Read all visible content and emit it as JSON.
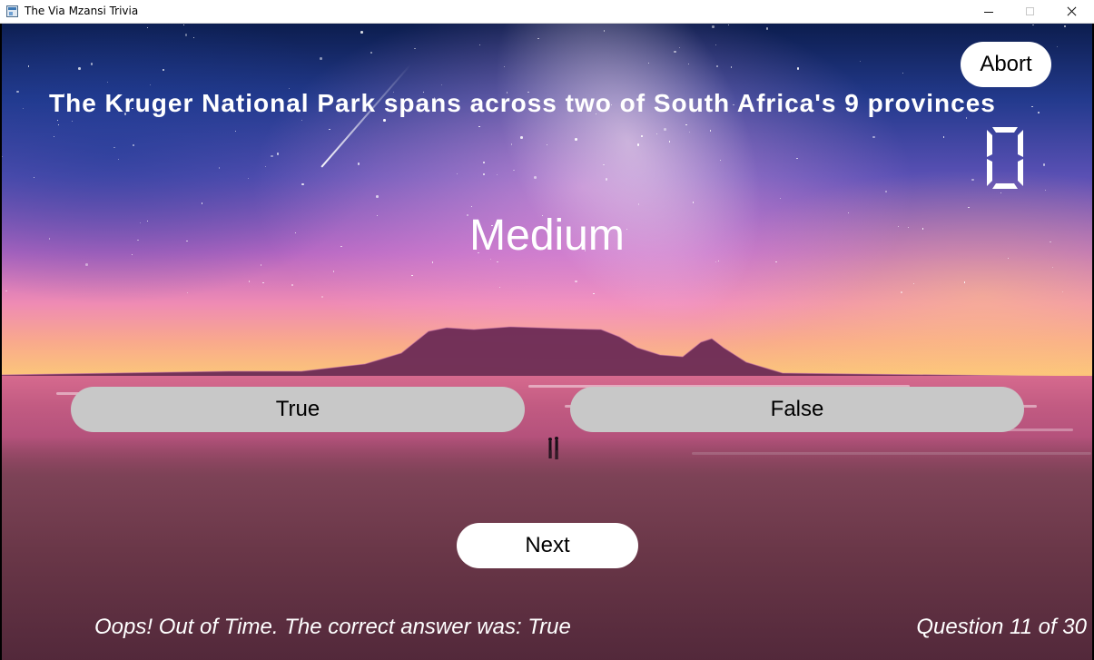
{
  "window": {
    "title": "The Via Mzansi Trivia"
  },
  "game": {
    "question": "The Kruger National Park spans across two of South Africa's 9 provinces",
    "difficulty": "Medium",
    "timer": "0",
    "answers": [
      {
        "label": "True"
      },
      {
        "label": "False"
      }
    ],
    "abort_label": "Abort",
    "next_label": "Next",
    "feedback": "Oops! Out of Time. The correct answer was: True",
    "progress": "Question 11 of 30"
  }
}
